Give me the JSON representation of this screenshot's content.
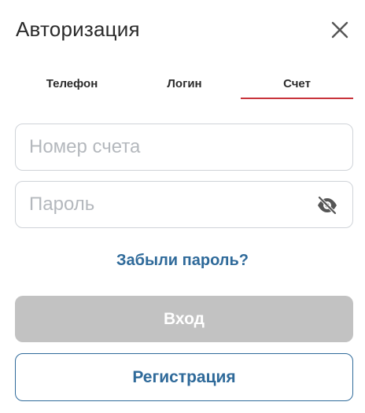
{
  "header": {
    "title": "Авторизация",
    "close_icon": "close-icon"
  },
  "tabs": [
    {
      "label": "Телефон",
      "active": false
    },
    {
      "label": "Логин",
      "active": false
    },
    {
      "label": "Счет",
      "active": true
    }
  ],
  "form": {
    "account_placeholder": "Номер счета",
    "account_value": "",
    "password_placeholder": "Пароль",
    "password_value": "",
    "password_toggle_icon": "eye-off-icon"
  },
  "links": {
    "forgot_password": "Забыли пароль?"
  },
  "buttons": {
    "login": "Вход",
    "register": "Регистрация"
  },
  "colors": {
    "accent_blue": "#2f6a9a",
    "tab_underline": "#c8343b",
    "disabled_button": "#c2c2c2"
  }
}
